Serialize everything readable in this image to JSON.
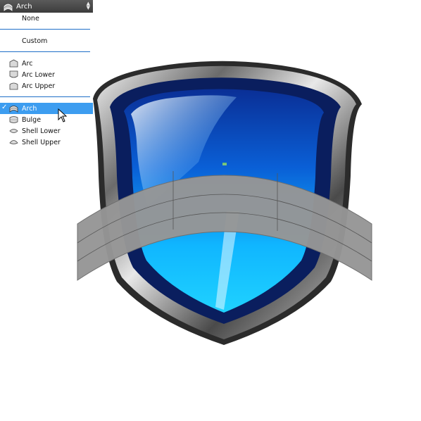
{
  "dropdown": {
    "selected_label": "Arch",
    "items": [
      {
        "label": "None"
      },
      {
        "label": "Custom"
      },
      {
        "label": "Arc"
      },
      {
        "label": "Arc Lower"
      },
      {
        "label": "Arc Upper"
      },
      {
        "label": "Arch"
      },
      {
        "label": "Bulge"
      },
      {
        "label": "Shell Lower"
      },
      {
        "label": "Shell Upper"
      }
    ]
  },
  "colors": {
    "highlight": "#3d9df0",
    "separator": "#1e6fc8",
    "header_bg": "#4a4a4a",
    "shield_blue_dark": "#0b2e8a",
    "shield_blue_light": "#1ec8ff",
    "warp_grid_fill": "#969696"
  }
}
